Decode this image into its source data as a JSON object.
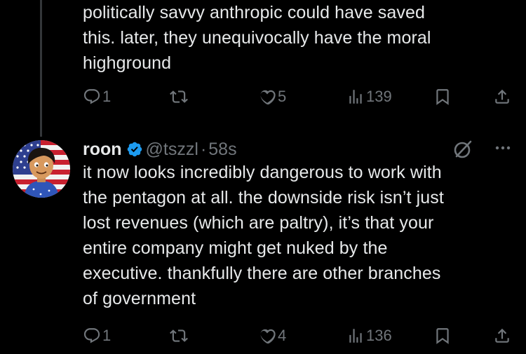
{
  "tweet1": {
    "text": "politically savvy anthropic could have saved\nthis. later, they unequivocally have the moral\nhighground",
    "actions": {
      "replies": "1",
      "reposts": "",
      "likes": "5",
      "views": "139"
    }
  },
  "tweet2": {
    "author": {
      "display_name": "roon",
      "handle": "@tszzl",
      "time": "58s",
      "verified": true
    },
    "separator": "·",
    "text": "it now looks incredibly dangerous to work with\nthe pentagon at all. the downside risk isn’t just\nlost revenues (which are paltry), it’s that your\nentire company might get nuked by the\nexecutive. thankfully there are other branches\nof government",
    "actions": {
      "replies": "1",
      "reposts": "",
      "likes": "4",
      "views": "136"
    }
  },
  "colors": {
    "background": "#000000",
    "text_primary": "#e7e9ea",
    "text_secondary": "#71767b",
    "verified_blue": "#1d9bf0",
    "thread_line": "#333639"
  },
  "icons": {
    "reply": "reply-icon",
    "repost": "repost-icon",
    "like": "heart-icon",
    "views": "views-icon",
    "bookmark": "bookmark-icon",
    "share": "share-icon",
    "verified": "verified-badge-icon",
    "grok": "grok-icon",
    "more": "more-icon"
  }
}
